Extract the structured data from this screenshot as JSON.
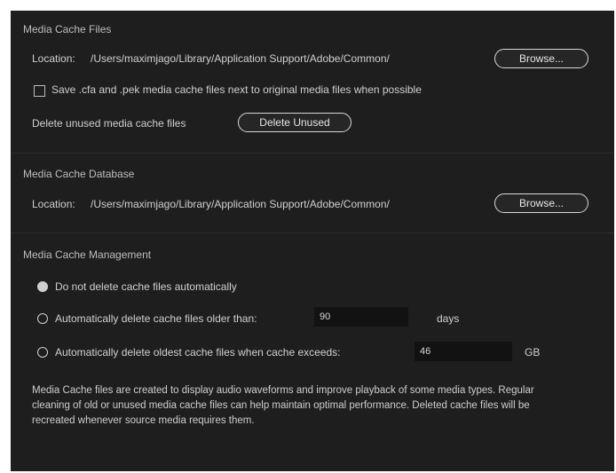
{
  "media_cache_files": {
    "title": "Media Cache Files",
    "location_label": "Location:",
    "location_path": "/Users/maximjago/Library/Application Support/Adobe/Common/",
    "browse_label": "Browse...",
    "save_checkbox_label": "Save .cfa and .pek media cache files next to original media files when possible",
    "save_checkbox_checked": false,
    "delete_unused_label": "Delete unused media cache files",
    "delete_unused_button": "Delete Unused"
  },
  "media_cache_database": {
    "title": "Media Cache Database",
    "location_label": "Location:",
    "location_path": "/Users/maximjago/Library/Application Support/Adobe/Common/",
    "browse_label": "Browse..."
  },
  "media_cache_management": {
    "title": "Media Cache Management",
    "options": [
      {
        "label": "Do not delete cache files automatically",
        "selected": true
      },
      {
        "label": "Automatically delete cache files older than:",
        "value": "90",
        "unit": "days",
        "selected": false
      },
      {
        "label": "Automatically delete oldest cache files when cache exceeds:",
        "value": "46",
        "unit": "GB",
        "selected": false
      }
    ],
    "description": "Media Cache files are created to display audio waveforms and improve playback of some media types. Regular cleaning of old or unused media cache files can help maintain optimal performance. Deleted cache files will be recreated whenever source media requires them."
  }
}
